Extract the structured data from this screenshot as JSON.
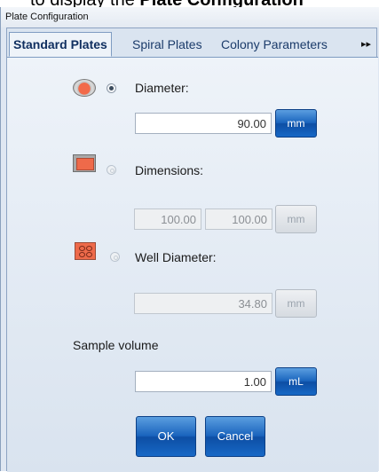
{
  "caption": {
    "prefix": "to display the ",
    "bold": "Plate Configuration"
  },
  "window": {
    "title": "Plate Configuration"
  },
  "tabs": [
    {
      "label": "Standard Plates",
      "active": true
    },
    {
      "label": "Spiral Plates",
      "active": false
    },
    {
      "label": "Colony Parameters",
      "active": false
    }
  ],
  "tab_scroll_glyph": "▸▸",
  "diameter": {
    "label": "Diameter:",
    "value": "90.00",
    "unit": "mm",
    "selected": true
  },
  "dimensions": {
    "label": "Dimensions:",
    "width": "100.00",
    "height": "100.00",
    "unit": "mm",
    "selected": false
  },
  "well_diameter": {
    "label": "Well Diameter:",
    "value": "34.80",
    "unit": "mm",
    "selected": false
  },
  "sample_volume": {
    "label": "Sample volume",
    "value": "1.00",
    "unit": "mL"
  },
  "buttons": {
    "ok": "OK",
    "cancel": "Cancel"
  },
  "colors": {
    "button_blue": "#1a64bd",
    "dish_red": "#f26a4a",
    "panel_bg": "#eef3f9"
  },
  "icons": [
    "petri-dish-icon",
    "rectangular-plate-icon",
    "well-plate-icon"
  ]
}
